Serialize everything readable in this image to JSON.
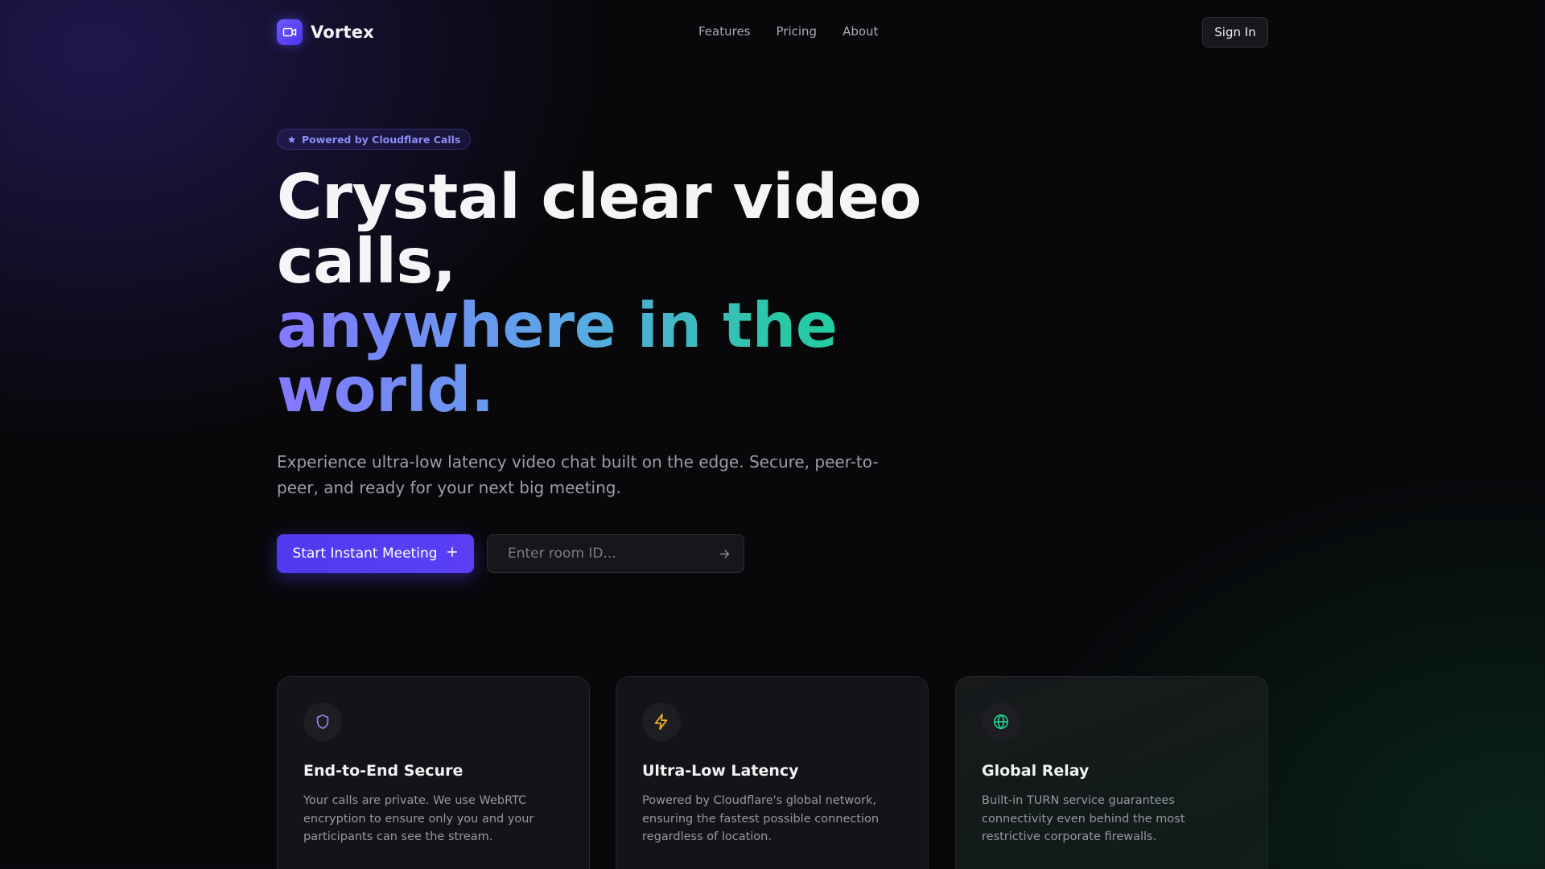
{
  "brand": {
    "name": "Vortex",
    "logo_icon": "video-camera-icon",
    "accent": "#5b45f5"
  },
  "nav": {
    "links": [
      {
        "label": "Features"
      },
      {
        "label": "Pricing"
      },
      {
        "label": "About"
      }
    ],
    "signin_label": "Sign In"
  },
  "hero": {
    "badge": {
      "icon": "star-icon",
      "text": "Powered by Cloudflare Calls"
    },
    "headline_line1": "Crystal clear video calls,",
    "headline_line2": "anywhere in the world.",
    "subtext": "Experience ultra-low latency video chat built on the edge. Secure, peer-to-peer, and ready for your next big meeting.",
    "cta_label": "Start Instant Meeting",
    "cta_icon": "plus-icon",
    "room_input": {
      "value": "",
      "placeholder": "Enter room ID...",
      "submit_icon": "arrow-right-icon"
    }
  },
  "features": [
    {
      "icon": "shield-icon",
      "icon_color": "#8b8cf6",
      "title": "End-to-End Secure",
      "description": "Your calls are private. We use WebRTC encryption to ensure only you and your participants can see the stream."
    },
    {
      "icon": "lightning-icon",
      "icon_color": "#f5b324",
      "title": "Ultra-Low Latency",
      "description": "Powered by Cloudflare's global network, ensuring the fastest possible connection regardless of location."
    },
    {
      "icon": "globe-icon",
      "icon_color": "#1fcf8f",
      "title": "Global Relay",
      "description": "Built-in TURN service guarantees connectivity even behind the most restrictive corporate firewalls."
    }
  ]
}
